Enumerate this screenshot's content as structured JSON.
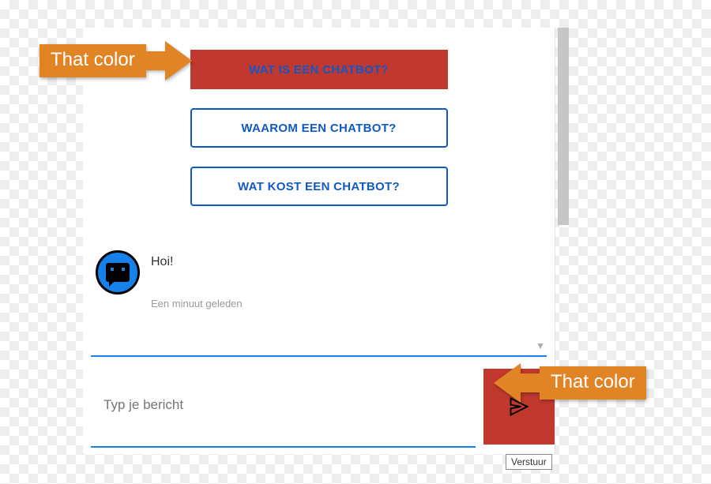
{
  "options": {
    "btn1": "WAT IS EEN CHATBOT?",
    "btn2": "WAAROM EEN CHATBOT?",
    "btn3": "WAT KOST EEN CHATBOT?"
  },
  "bot": {
    "message": "Hoi!",
    "timestamp": "Een minuut geleden"
  },
  "input": {
    "placeholder": "Typ je bericht",
    "send_tooltip": "Verstuur"
  },
  "annotations": {
    "top_label": "That color",
    "bottom_label": "That color"
  },
  "colors": {
    "accent_red": "#c1392e",
    "accent_blue": "#1158c7",
    "annotation_orange": "#e08426"
  }
}
